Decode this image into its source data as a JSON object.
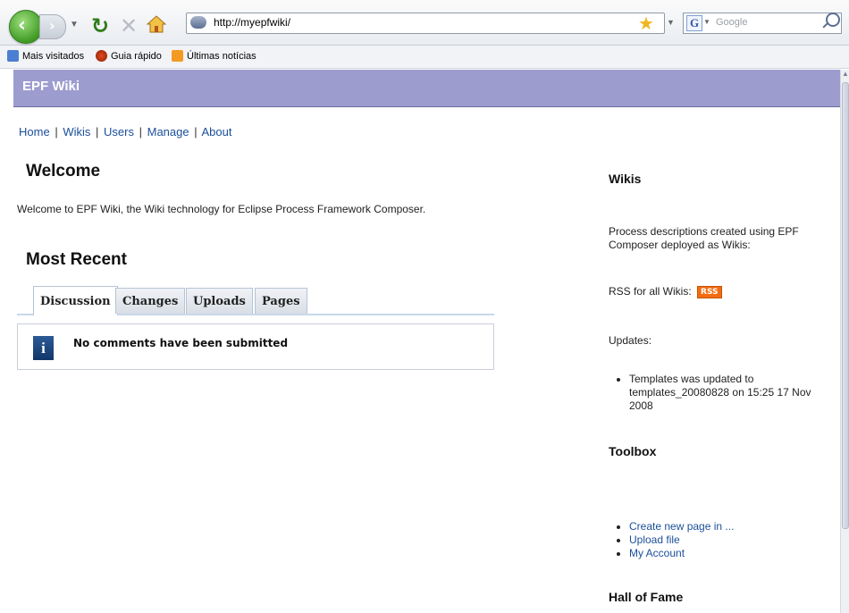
{
  "browser": {
    "url": "http://myepfwiki/",
    "search_placeholder": "Google",
    "search_engine_letter": "G",
    "bookmarks": [
      "Mais visitados",
      "Guia rápido",
      "Últimas notícias"
    ]
  },
  "header": {
    "title": "EPF Wiki"
  },
  "nav": {
    "home": "Home",
    "wikis": "Wikis",
    "users": "Users",
    "manage": "Manage",
    "about": "About",
    "separator": "|"
  },
  "main": {
    "welcome_heading": "Welcome",
    "welcome_text": "Welcome to EPF Wiki, the Wiki technology for Eclipse Process Framework Composer.",
    "recent_heading": "Most Recent",
    "tabs": [
      "Discussion",
      "Changes",
      "Uploads",
      "Pages"
    ],
    "active_tab": "Discussion",
    "info_icon_glyph": "i",
    "empty_message": "No comments have been submitted"
  },
  "sidebar": {
    "wikis_heading": "Wikis",
    "wikis_text": "Process descriptions created using EPF Composer deployed as Wikis:",
    "rss_text": "RSS for all Wikis:",
    "rss_badge": "RSS",
    "updates_label": "Updates:",
    "updates": [
      "Templates was updated to templates_20080828 on 15:25 17 Nov 2008"
    ],
    "toolbox_heading": "Toolbox",
    "toolbox_links": [
      "Create new page in ...",
      "Upload file",
      "My Account"
    ],
    "hall_heading": "Hall of Fame"
  }
}
